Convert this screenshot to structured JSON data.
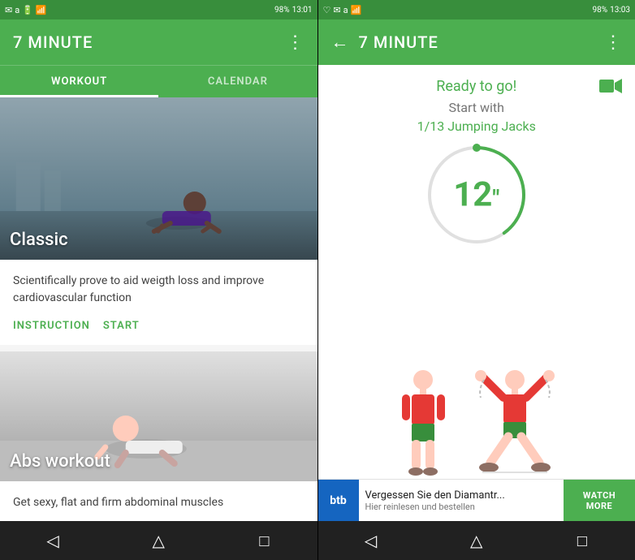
{
  "left": {
    "statusBar": {
      "time": "13:01",
      "battery": "98%"
    },
    "appBar": {
      "title": "7 MINUTE",
      "menuIcon": "⋮"
    },
    "tabs": [
      {
        "label": "WORKOUT",
        "active": true
      },
      {
        "label": "CALENDAR",
        "active": false
      }
    ],
    "cards": [
      {
        "id": "classic",
        "title": "Classic",
        "description": "Scientifically prove to aid weigth loss and improve cardiovascular function",
        "actions": [
          {
            "label": "INSTRUCTION"
          },
          {
            "label": "START"
          }
        ]
      },
      {
        "id": "abs",
        "title": "Abs workout",
        "description": "Get sexy, flat and firm abdominal muscles"
      }
    ],
    "nav": {
      "back": "◁",
      "home": "△",
      "recent": "□"
    }
  },
  "right": {
    "statusBar": {
      "time": "13:03",
      "battery": "98%"
    },
    "appBar": {
      "backIcon": "←",
      "title": "7 MINUTE",
      "menuIcon": "⋮"
    },
    "workout": {
      "readyText": "Ready to go!",
      "startWithText": "Start with",
      "exerciseText": "1/13 Jumping Jacks",
      "timerValue": "12",
      "timerUnit": "\""
    },
    "ad": {
      "logo": "btb",
      "title": "Vergessen Sie den Diamantr...",
      "subtitle": "Hier reinlesen und bestellen",
      "cta": "WATCH MORE"
    },
    "nav": {
      "back": "◁",
      "home": "△",
      "recent": "□"
    }
  }
}
